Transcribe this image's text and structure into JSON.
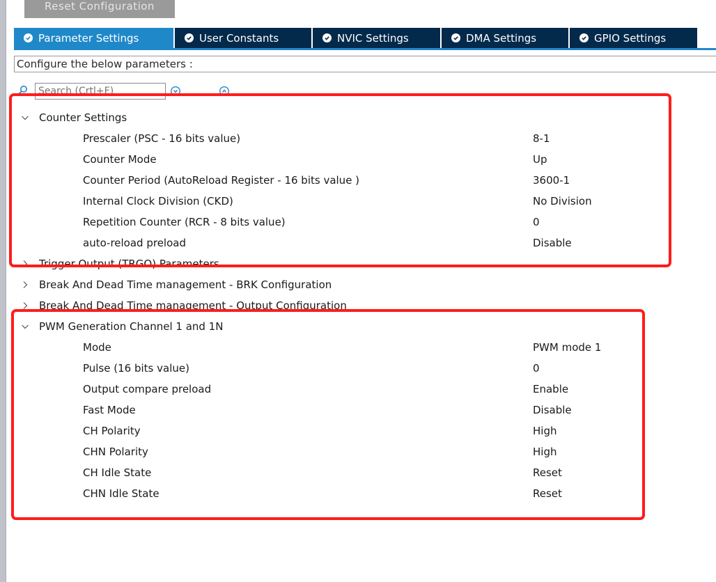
{
  "toolbar": {
    "reset_label": "Reset Configuration"
  },
  "tabs": [
    {
      "label": "Parameter Settings",
      "active": true
    },
    {
      "label": "User Constants",
      "active": false
    },
    {
      "label": "NVIC Settings",
      "active": false
    },
    {
      "label": "DMA Settings",
      "active": false
    },
    {
      "label": "GPIO Settings",
      "active": false
    }
  ],
  "configure_label": "Configure the below parameters :",
  "search": {
    "placeholder": "Search (Crtl+F)"
  },
  "groups": [
    {
      "name": "Counter Settings",
      "expanded": true,
      "params": [
        {
          "label": "Prescaler (PSC - 16 bits value)",
          "value": "8-1"
        },
        {
          "label": "Counter Mode",
          "value": "Up"
        },
        {
          "label": "Counter Period (AutoReload Register - 16 bits value )",
          "value": "3600-1"
        },
        {
          "label": "Internal Clock Division (CKD)",
          "value": "No Division"
        },
        {
          "label": "Repetition Counter (RCR - 8 bits value)",
          "value": "0"
        },
        {
          "label": "auto-reload preload",
          "value": "Disable"
        }
      ]
    },
    {
      "name": "Trigger Output (TRGO) Parameters",
      "expanded": false,
      "params": []
    },
    {
      "name": "Break And Dead Time management - BRK Configuration",
      "expanded": false,
      "params": []
    },
    {
      "name": "Break And Dead Time management - Output Configuration",
      "expanded": false,
      "params": []
    },
    {
      "name": "PWM Generation Channel 1 and 1N",
      "expanded": true,
      "params": [
        {
          "label": "Mode",
          "value": "PWM mode 1"
        },
        {
          "label": "Pulse (16 bits value)",
          "value": "0"
        },
        {
          "label": "Output compare preload",
          "value": "Enable"
        },
        {
          "label": "Fast Mode",
          "value": "Disable"
        },
        {
          "label": "CH Polarity",
          "value": "High"
        },
        {
          "label": "CHN Polarity",
          "value": "High"
        },
        {
          "label": "CH Idle State",
          "value": "Reset"
        },
        {
          "label": "CHN Idle State",
          "value": "Reset"
        }
      ]
    }
  ],
  "colors": {
    "tab_active": "#1f88c9",
    "tab_inactive": "#03294b",
    "highlight": "#ff1c1c"
  },
  "icons": [
    "check-circle-icon",
    "search-icon",
    "expand-all-icon",
    "collapse-all-icon",
    "chevron-down-icon",
    "chevron-right-icon"
  ]
}
